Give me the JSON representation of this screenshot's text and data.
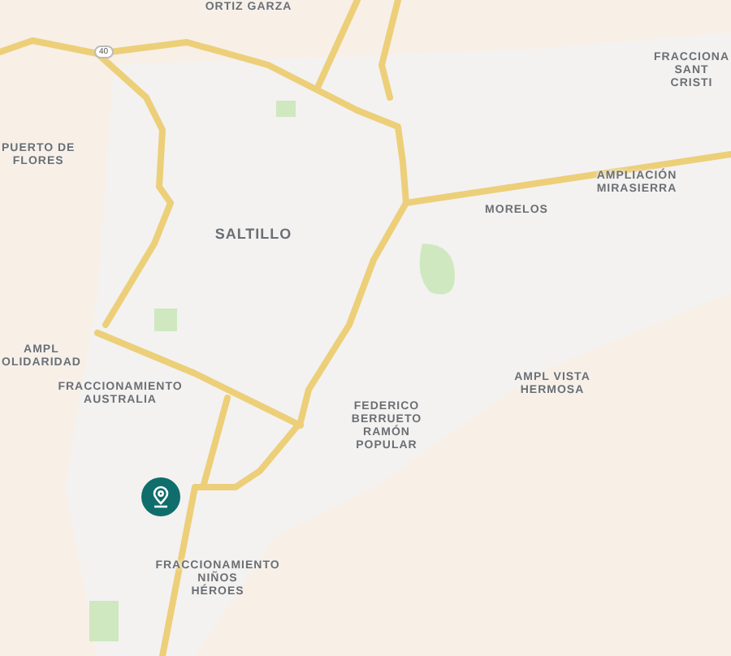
{
  "map": {
    "area_labels": [
      {
        "lines": [
          "ORTIZ GARZA"
        ]
      },
      {
        "lines": [
          "FRACCIONA",
          "SANT",
          "CRISTI"
        ]
      },
      {
        "lines": [
          "PUERTO DE",
          "FLORES"
        ]
      },
      {
        "lines": [
          "SALTILLO"
        ]
      },
      {
        "lines": [
          "AMPLIACIÓN",
          "MIRASIERRA"
        ]
      },
      {
        "lines": [
          "MORELOS"
        ]
      },
      {
        "lines": [
          "AMPL",
          "OLIDARIDAD"
        ]
      },
      {
        "lines": [
          "FRACCIONAMIENTO",
          "AUSTRALIA"
        ]
      },
      {
        "lines": [
          "FEDERICO",
          "BERRUETO",
          "RAMÓN",
          "POPULAR"
        ]
      },
      {
        "lines": [
          "AMPL VISTA",
          "HERMOSA"
        ]
      },
      {
        "lines": [
          "FRACCIONAMIENTO",
          "NIÑOS",
          "HÉROES"
        ]
      }
    ],
    "road_shield": "40",
    "pin": {
      "color": "#0f6e6b"
    }
  }
}
